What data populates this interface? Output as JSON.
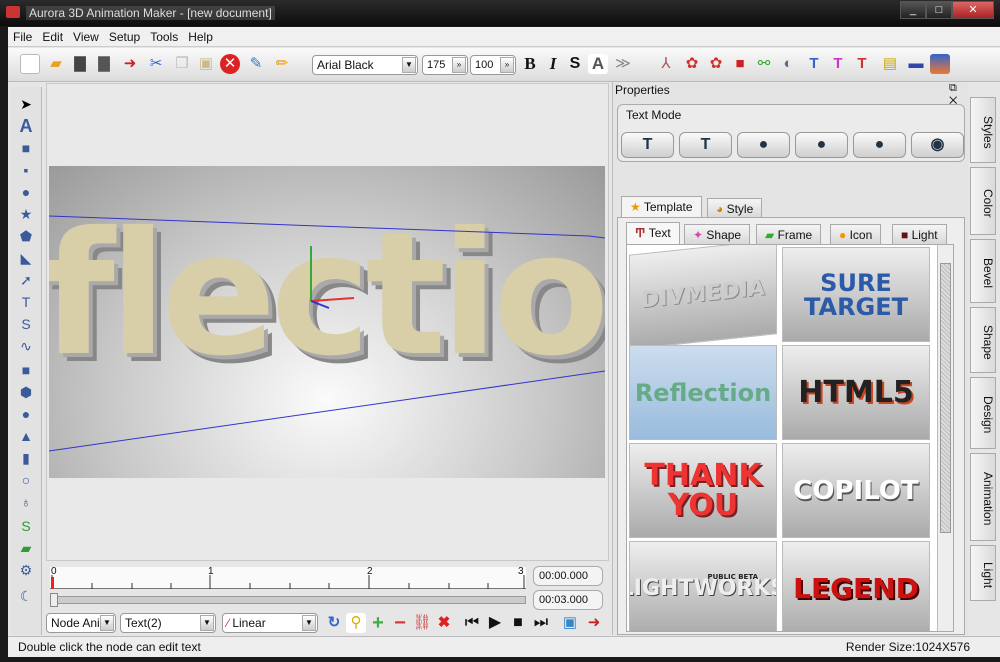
{
  "window": {
    "title": "Aurora 3D Animation Maker - [new document]",
    "controls": [
      "_",
      "□",
      "✕"
    ]
  },
  "menu": [
    "File",
    "Edit",
    "View",
    "Setup",
    "Tools",
    "Help"
  ],
  "toolbar": {
    "font": "Arial Black",
    "size": "175",
    "scale": "100",
    "bold": "B",
    "italic": "I",
    "shadow": "S",
    "outline": "A"
  },
  "viewport": {
    "text": "flection"
  },
  "timeline": {
    "ticks": [
      "0",
      "1",
      "2",
      "3"
    ],
    "current_time": "00:00.000",
    "total_time": "00:03.000",
    "progress": 0
  },
  "anim_controls": {
    "mode": "Node Ani",
    "node": "Text(2)",
    "interpolation": "Linear"
  },
  "properties": {
    "title": "Properties",
    "text_mode_label": "Text Mode",
    "tabs": [
      "Template",
      "Style"
    ],
    "subtabs": [
      "Text",
      "Shape",
      "Frame",
      "Icon",
      "Light"
    ],
    "templates": [
      "DIVMEDIA",
      "SURE TARGET",
      "Reflection",
      "HTML5",
      "THANK YOU",
      "COPILOT",
      "LIGHTWORKS",
      "LEGEND"
    ],
    "template_extra": {
      "lightworks_badge": "PUBLIC BETA"
    }
  },
  "side_tabs": [
    "Styles",
    "Color",
    "Bevel",
    "Shape",
    "Design",
    "Animation",
    "Light"
  ],
  "status": {
    "message": "Double click the node can edit text",
    "render_size": "Render Size:1024X576"
  }
}
